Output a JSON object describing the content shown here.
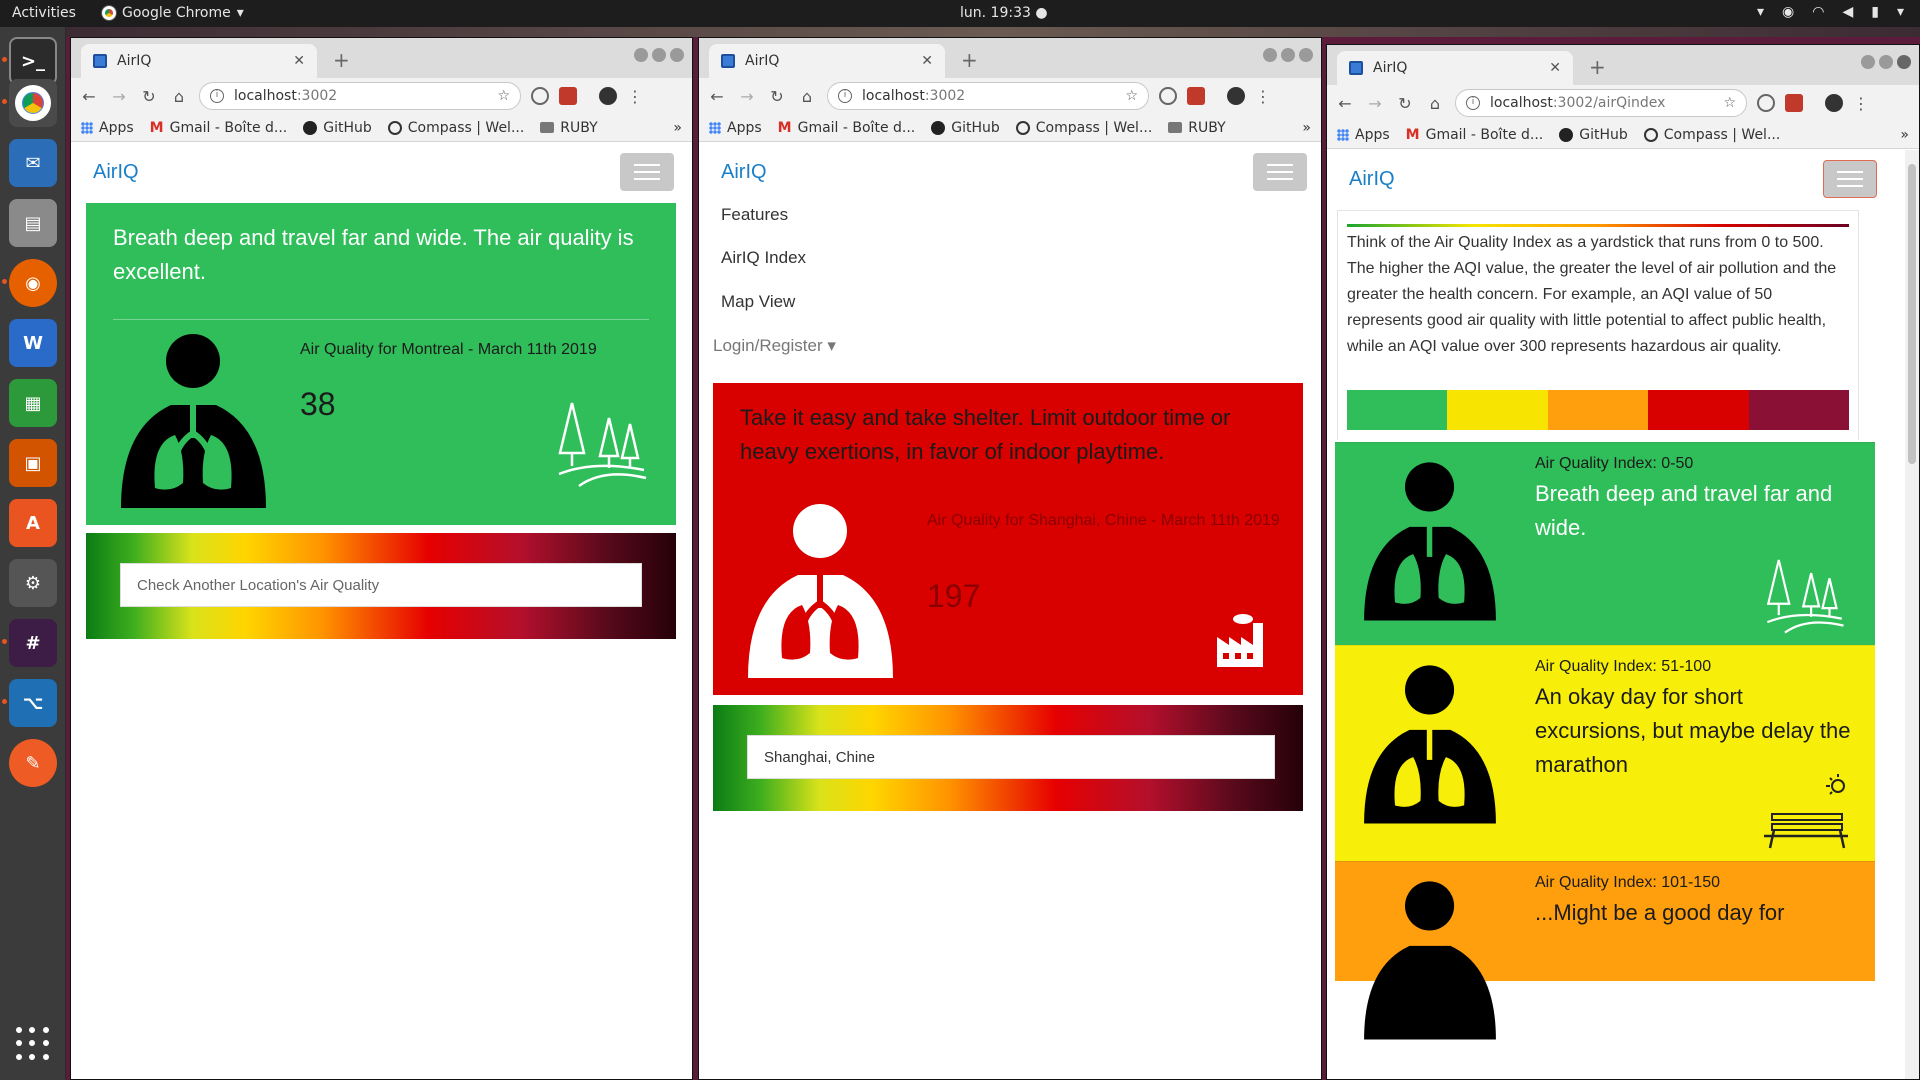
{
  "topbar": {
    "activities": "Activities",
    "app_name": "Google Chrome",
    "app_menu_arrow": "▾",
    "clock": "lun. 19:33 ●",
    "tray_icons": [
      "chevron-down-icon",
      "record-icon",
      "wifi-icon",
      "volume-icon",
      "battery-icon",
      "power-menu-icon"
    ]
  },
  "dock": {
    "items": [
      "terminal",
      "chrome",
      "thunderbird",
      "files",
      "firefox",
      "writer",
      "calc",
      "impress",
      "software",
      "settings",
      "slack",
      "vscode",
      "postman"
    ]
  },
  "bookmarks": {
    "apps": "Apps",
    "gmail": "Gmail - Boîte d...",
    "github": "GitHub",
    "compass": "Compass | Wel...",
    "ruby": "RUBY",
    "more": "»"
  },
  "window1": {
    "tab_title": "AirIQ",
    "url_host": "localhost",
    "url_rest": ":3002",
    "brand": "AirIQ",
    "message": "Breath deep and travel far and wide. The air quality is excellent.",
    "aq_title": "Air Quality for Montreal - March 11th 2019",
    "aq_value": "38",
    "search_placeholder": "Check Another Location's Air Quality",
    "card_color": "#2fbe5a"
  },
  "window2": {
    "tab_title": "AirIQ",
    "url_host": "localhost",
    "url_rest": ":3002",
    "brand": "AirIQ",
    "menu": [
      "Features",
      "AirIQ Index",
      "Map View"
    ],
    "dropdown": "Login/Register ▾",
    "message": "Take it easy and take shelter. Limit outdoor time or heavy exertions, in favor of indoor playtime.",
    "aq_title": "Air Quality for Shanghai, Chine - March 11th 2019",
    "aq_value": "197",
    "search_value": "Shanghai, Chine",
    "card_color": "#d90000"
  },
  "window3": {
    "tab_title": "AirIQ",
    "url_host": "localhost",
    "url_rest": ":3002/airQindex",
    "brand": "AirIQ",
    "intro": "Think of the Air Quality Index as a yardstick that runs from 0 to 500. The higher the AQI value, the greater the level of air pollution and the greater the health concern. For example, an AQI value of 50 represents good air quality with little potential to affect public health, while an AQI value over 300 represents hazardous air quality.",
    "swatch_colors": [
      "#2fbe5a",
      "#f7e400",
      "#ff9f0d",
      "#d90000",
      "#8b1035"
    ],
    "levels": [
      {
        "label": "Air Quality Index: 0-50",
        "desc": "Breath deep and travel far and wide.",
        "color": "#2fbe5a",
        "icon": "trees-icon"
      },
      {
        "label": "Air Quality Index: 51-100",
        "desc": "An okay day for short excursions, but maybe delay the marathon",
        "color": "#f7ef0a",
        "icon": "bench-icon"
      },
      {
        "label": "Air Quality Index: 101-150",
        "desc": "...Might be a good day for",
        "color": "#ff9f0d",
        "icon": "person-icon"
      }
    ]
  }
}
